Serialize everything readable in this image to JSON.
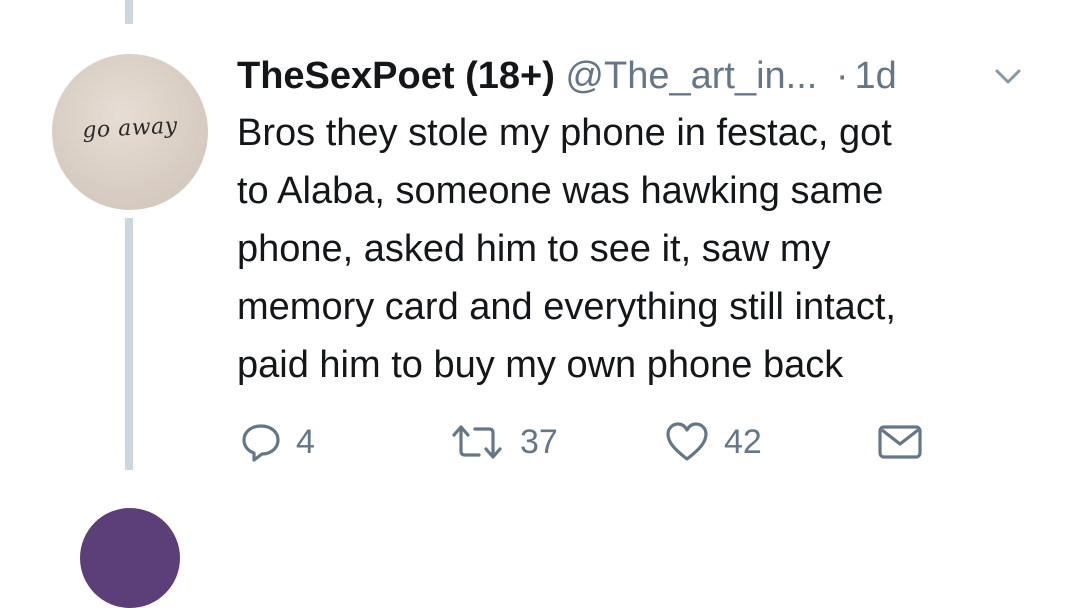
{
  "tweet": {
    "display_name": "TheSexPoet (18+)",
    "handle": "@The_art_in...",
    "separator": "·",
    "time": "1d",
    "avatar_text": "go away",
    "text": "Bros they stole my phone in festac, got\nto Alaba, someone was hawking same\nphone, asked him to see it, saw my\nmemory card and everything still intact,\npaid him to buy my own phone back",
    "actions": {
      "replies": "4",
      "retweets": "37",
      "likes": "42"
    },
    "icons": {
      "reply": "reply-icon",
      "retweet": "retweet-icon",
      "like": "heart-icon",
      "share": "mail-icon",
      "menu": "chevron-down-icon"
    }
  },
  "colors": {
    "text": "#14171a",
    "secondary": "#657786",
    "thread_line": "#ccd6dd"
  }
}
